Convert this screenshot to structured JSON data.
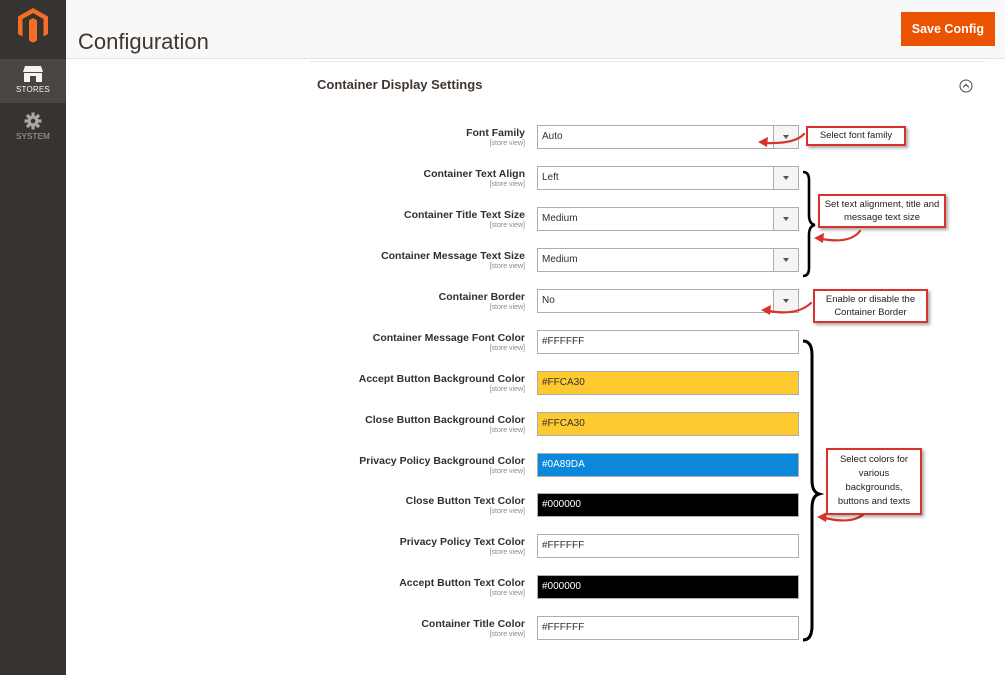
{
  "sidebar": {
    "items": [
      {
        "label": "STORES",
        "icon": "store-icon",
        "active": true
      },
      {
        "label": "SYSTEM",
        "icon": "gear-icon",
        "active": false
      }
    ]
  },
  "header": {
    "title": "Configuration",
    "save_label": "Save Config"
  },
  "section": {
    "title": "Container Display Settings"
  },
  "fields": [
    {
      "label": "Font Family",
      "scope": "[store view]",
      "value": "Auto",
      "type": "select"
    },
    {
      "label": "Container Text Align",
      "scope": "[store view]",
      "value": "Left",
      "type": "select"
    },
    {
      "label": "Container Title Text Size",
      "scope": "[store view]",
      "value": "Medium",
      "type": "select"
    },
    {
      "label": "Container Message Text Size",
      "scope": "[store view]",
      "value": "Medium",
      "type": "select"
    },
    {
      "label": "Container Border",
      "scope": "[store view]",
      "value": "No",
      "type": "select"
    },
    {
      "label": "Container Message Font Color",
      "scope": "[store view]",
      "value": "#FFFFFF",
      "type": "color",
      "bg": "#FFFFFF",
      "fg": "#303030"
    },
    {
      "label": "Accept Button Background Color",
      "scope": "[store view]",
      "value": "#FFCA30",
      "type": "color",
      "bg": "#FFCA30",
      "fg": "#303030"
    },
    {
      "label": "Close Button Background Color",
      "scope": "[store view]",
      "value": "#FFCA30",
      "type": "color",
      "bg": "#FFCA30",
      "fg": "#303030"
    },
    {
      "label": "Privacy Policy Background Color",
      "scope": "[store view]",
      "value": "#0A89DA",
      "type": "color",
      "bg": "#0A89DA",
      "fg": "#FFFFFF"
    },
    {
      "label": "Close Button Text Color",
      "scope": "[store view]",
      "value": "#000000",
      "type": "color",
      "bg": "#000000",
      "fg": "#FFFFFF"
    },
    {
      "label": "Privacy Policy Text Color",
      "scope": "[store view]",
      "value": "#FFFFFF",
      "type": "color",
      "bg": "#FFFFFF",
      "fg": "#303030"
    },
    {
      "label": "Accept Button Text Color",
      "scope": "[store view]",
      "value": "#000000",
      "type": "color",
      "bg": "#000000",
      "fg": "#FFFFFF"
    },
    {
      "label": "Container Title Color",
      "scope": "[store view]",
      "value": "#FFFFFF",
      "type": "color",
      "bg": "#FFFFFF",
      "fg": "#303030"
    }
  ],
  "annotations": {
    "font_family": "Select font family",
    "alignment": "Set text alignment, title and message text size",
    "border": "Enable or disable the Container Border",
    "colors": "Select colors for various backgrounds, buttons and texts"
  },
  "colors": {
    "accent": "#EB5202",
    "sidebar": "#373330",
    "annotation_border": "#D9322B"
  }
}
